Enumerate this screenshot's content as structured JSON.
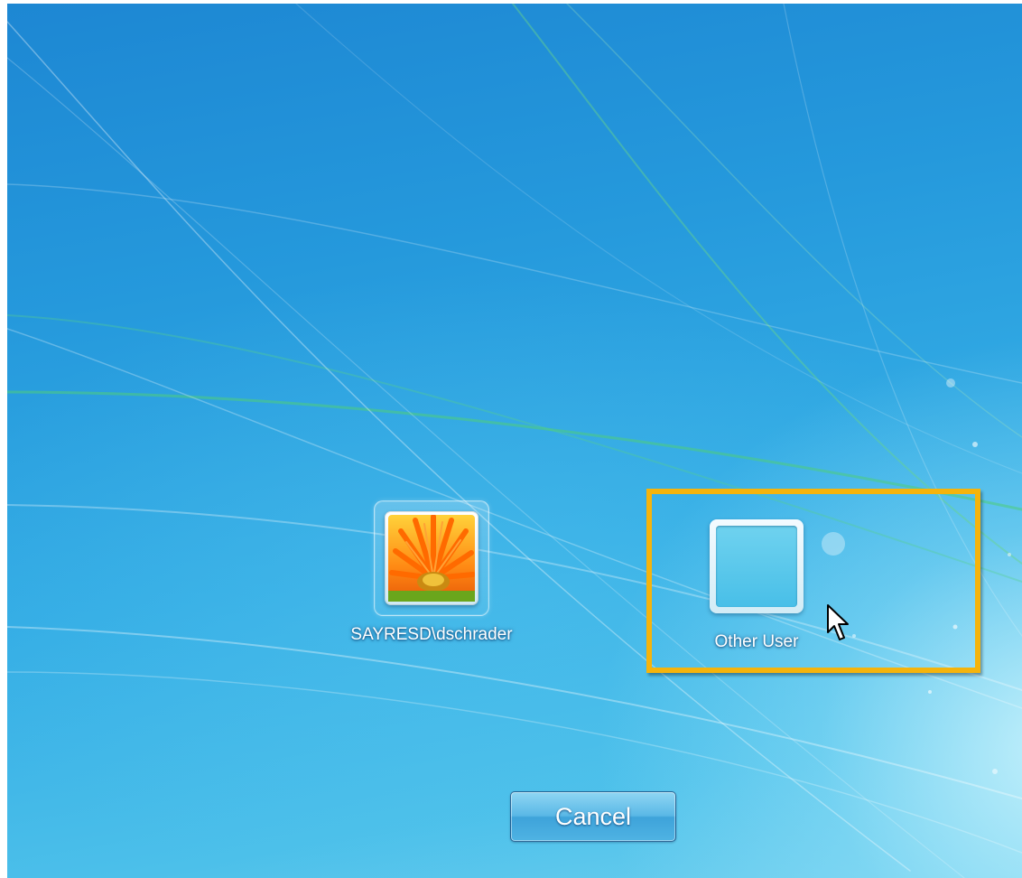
{
  "users": [
    {
      "name": "SAYRESD\\dschrader",
      "picture": "orange-gerbera-flower"
    },
    {
      "name": "Other User",
      "picture": "blank"
    }
  ],
  "buttons": {
    "cancel_label": "Cancel"
  },
  "colors": {
    "highlight": "#f5b40c",
    "background": "#2a9fe0"
  }
}
